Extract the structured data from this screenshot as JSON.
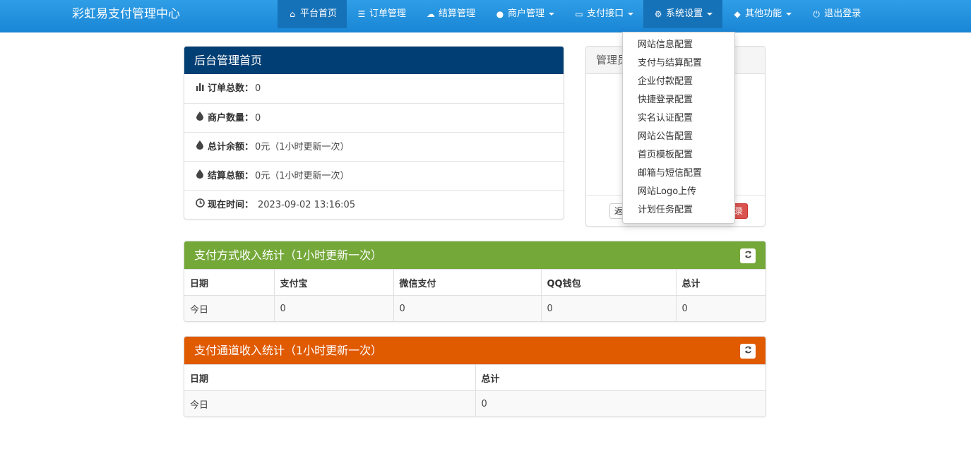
{
  "brand": "彩虹易支付管理中心",
  "nav": [
    {
      "label": "平台首页",
      "icon": "home-icon",
      "glyph": "⌂",
      "dropdown": false
    },
    {
      "label": "订单管理",
      "icon": "list-icon",
      "glyph": "☰",
      "dropdown": false
    },
    {
      "label": "结算管理",
      "icon": "cloud-icon",
      "glyph": "☁",
      "dropdown": false
    },
    {
      "label": "商户管理",
      "icon": "user-icon",
      "glyph": "●",
      "dropdown": true
    },
    {
      "label": "支付接口",
      "icon": "credit-card-icon",
      "glyph": "▭",
      "dropdown": true
    },
    {
      "label": "系统设置",
      "icon": "gear-icon",
      "glyph": "⚙",
      "dropdown": true
    },
    {
      "label": "其他功能",
      "icon": "cube-icon",
      "glyph": "◆",
      "dropdown": true
    },
    {
      "label": "退出登录",
      "icon": "power-icon",
      "glyph": "⏻",
      "dropdown": false
    }
  ],
  "settings_menu": [
    "网站信息配置",
    "支付与结算配置",
    "企业付款配置",
    "快捷登录配置",
    "实名认证配置",
    "网站公告配置",
    "首页模板配置",
    "邮箱与短信配置",
    "网站Logo上传",
    "计划任务配置"
  ],
  "admin_panel": {
    "title": "后台管理首页",
    "rows": [
      {
        "icon": "bar-chart-icon",
        "glyph": "▮",
        "label": "订单总数：",
        "value": "0"
      },
      {
        "icon": "tint-icon",
        "glyph": "💧",
        "label": "商户数量：",
        "value": "0"
      },
      {
        "icon": "tint-icon",
        "glyph": "💧",
        "label": "总计余额：",
        "value": "0元（1小时更新一次）"
      },
      {
        "icon": "tint-icon",
        "glyph": "💧",
        "label": "结算总额：",
        "value": "0元（1小时更新一次）"
      },
      {
        "icon": "clock-icon",
        "glyph": "◷",
        "label": "现在时间：",
        "value": "2023-09-02 13:16:05"
      }
    ]
  },
  "side_panel": {
    "title": "管理员",
    "btn_back": "返",
    "btn_red": "录"
  },
  "pay_method_stats": {
    "title": "支付方式收入统计（1小时更新一次）",
    "headers": [
      "日期",
      "支付宝",
      "微信支付",
      "QQ钱包",
      "总计"
    ],
    "rows": [
      [
        "今日",
        "0",
        "0",
        "0",
        "0"
      ]
    ]
  },
  "channel_stats": {
    "title": "支付通道收入统计（1小时更新一次）",
    "headers": [
      "日期",
      "总计"
    ],
    "rows": [
      [
        "今日",
        "0"
      ]
    ]
  }
}
